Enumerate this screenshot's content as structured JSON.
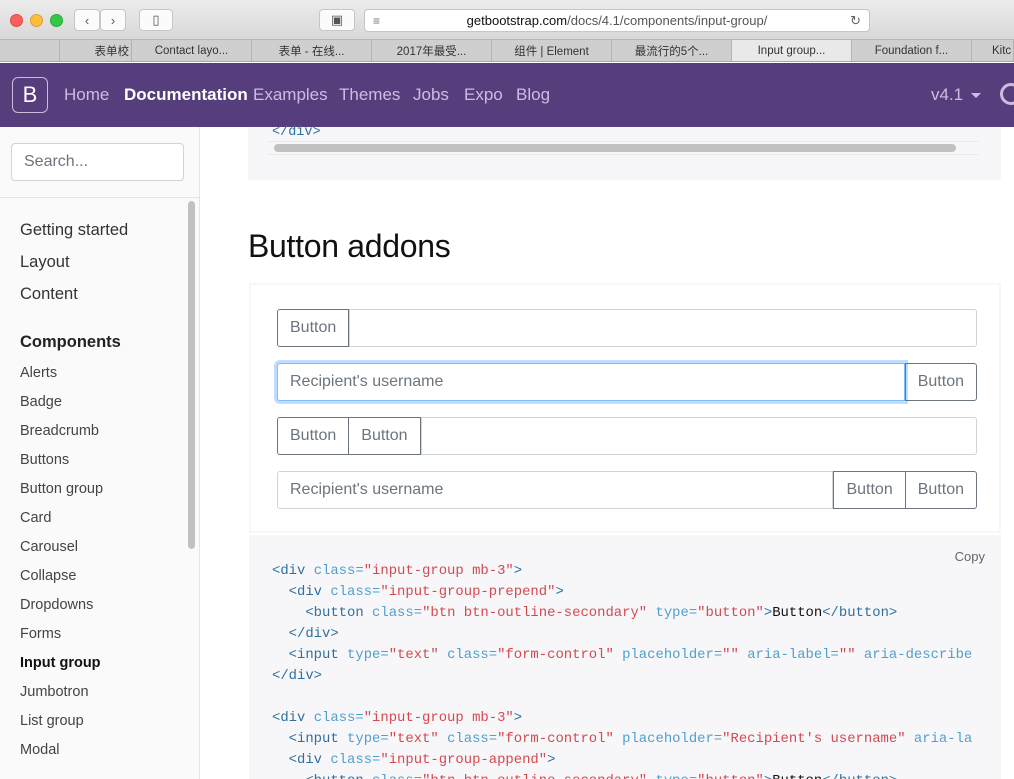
{
  "browser": {
    "url_host": "getbootstrap.com",
    "url_path": "/docs/4.1/components/input-group/",
    "tabs": [
      "表单校",
      "Contact layo...",
      "表单 - 在线...",
      "2017年最受...",
      "组件 | Element",
      "最流行的5个...",
      "Input group...",
      "Foundation f...",
      "Kitc"
    ]
  },
  "navbar": {
    "brand": "B",
    "links": [
      "Home",
      "Documentation",
      "Examples",
      "Themes",
      "Jobs",
      "Expo",
      "Blog"
    ],
    "version": "v4.1"
  },
  "sidebar": {
    "search_placeholder": "Search...",
    "sections": [
      "Getting started",
      "Layout",
      "Content",
      "Components"
    ],
    "items": [
      "Alerts",
      "Badge",
      "Breadcrumb",
      "Buttons",
      "Button group",
      "Card",
      "Carousel",
      "Collapse",
      "Dropdowns",
      "Forms",
      "Input group",
      "Jumbotron",
      "List group",
      "Modal"
    ]
  },
  "main": {
    "top_code_line": "</div>",
    "heading": "Button addons",
    "example": {
      "button_label": "Button",
      "placeholder": "Recipient's username"
    },
    "copy_label": "Copy"
  }
}
